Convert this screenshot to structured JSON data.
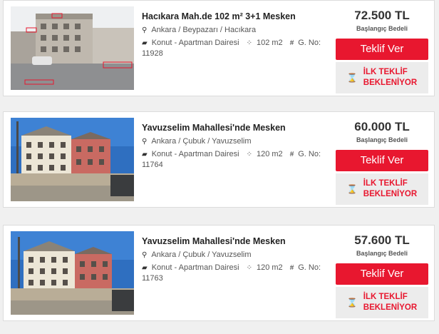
{
  "listings": [
    {
      "title": "Hacıkara Mah.de 102 m² 3+1 Mesken",
      "location": "Ankara / Beypazarı / Hacıkara",
      "type": "Konut - Apartman Dairesi",
      "area": "102 m2",
      "gno_label": "G. No:",
      "gno": "11928",
      "price": "72.500 TL",
      "price_label": "Başlangıç Bedeli",
      "offer_button": "Teklif Ver",
      "status_line1": "İLK TEKLİF",
      "status_line2": "BEKLENİYOR"
    },
    {
      "title": "Yavuzselim Mahallesi'nde Mesken",
      "location": "Ankara / Çubuk / Yavuzselim",
      "type": "Konut - Apartman Dairesi",
      "area": "120 m2",
      "gno_label": "G. No:",
      "gno": "11764",
      "price": "60.000 TL",
      "price_label": "Başlangıç Bedeli",
      "offer_button": "Teklif Ver",
      "status_line1": "İLK TEKLİF",
      "status_line2": "BEKLENİYOR"
    },
    {
      "title": "Yavuzselim Mahallesi'nde Mesken",
      "location": "Ankara / Çubuk / Yavuzselim",
      "type": "Konut - Apartman Dairesi",
      "area": "120 m2",
      "gno_label": "G. No:",
      "gno": "11763",
      "price": "57.600 TL",
      "price_label": "Başlangıç Bedeli",
      "offer_button": "Teklif Ver",
      "status_line1": "İLK TEKLİF",
      "status_line2": "BEKLENİYOR"
    }
  ],
  "icons": {
    "location": "map-pin-icon",
    "type": "building-icon",
    "area": "area-icon",
    "gno": "hashtag-icon",
    "status": "hourglass-icon"
  },
  "colors": {
    "accent": "#e8172f",
    "status_bg": "#ececec"
  }
}
